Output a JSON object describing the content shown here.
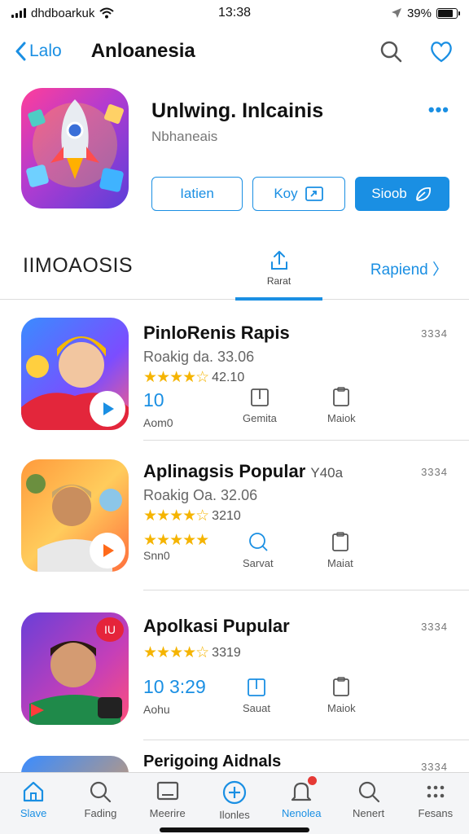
{
  "status_bar": {
    "carrier": "dhdboarkuk",
    "time": "13:38",
    "battery_pct": "39%",
    "battery_level": 0.39
  },
  "nav": {
    "back_label": "Lalo",
    "title": "Anloanesia"
  },
  "app": {
    "name": "Unlwing. Inlcainis",
    "subtitle": "Nbhaneais",
    "buttons": [
      "Iatien",
      "Koy",
      "Sioob"
    ]
  },
  "section": {
    "title": "IIMOAOSIS",
    "tab_label": "Rarat",
    "link_label": "Rapiend"
  },
  "items": [
    {
      "title": "PinloRenis Rapis",
      "meta": "Roakig da. 33.06",
      "rating_text": "42.10",
      "stars": "★★★★☆",
      "badge": "3334",
      "stat_value": "10",
      "stat_label": "Aom0",
      "tool1": "Gemita",
      "tool2": "Maiok"
    },
    {
      "title": "Aplinagsis Popular",
      "title_suffix": "Y40a",
      "meta": "Roakig Oa. 32.06",
      "rating_text": "3210",
      "stars": "★★★★☆",
      "stars2": "★★★★★",
      "badge": "3334",
      "stat_label": "Snn0",
      "tool1": "Sarvat",
      "tool2": "Maiat"
    },
    {
      "title": "Apolkasi Pupular",
      "rating_text": "3319",
      "stars": "★★★★☆",
      "badge": "3334",
      "stat_value": "10 3:29",
      "stat_label": "Aohu",
      "tool1": "Sauat",
      "tool2": "Maiok",
      "thumb_badge": "IU"
    },
    {
      "title": "Perigoing Aidnals",
      "badge": "3334"
    }
  ],
  "tabs": [
    "Slave",
    "Fading",
    "Meerire",
    "Ilonles",
    "Nenolea",
    "Nenert",
    "Fesans"
  ]
}
